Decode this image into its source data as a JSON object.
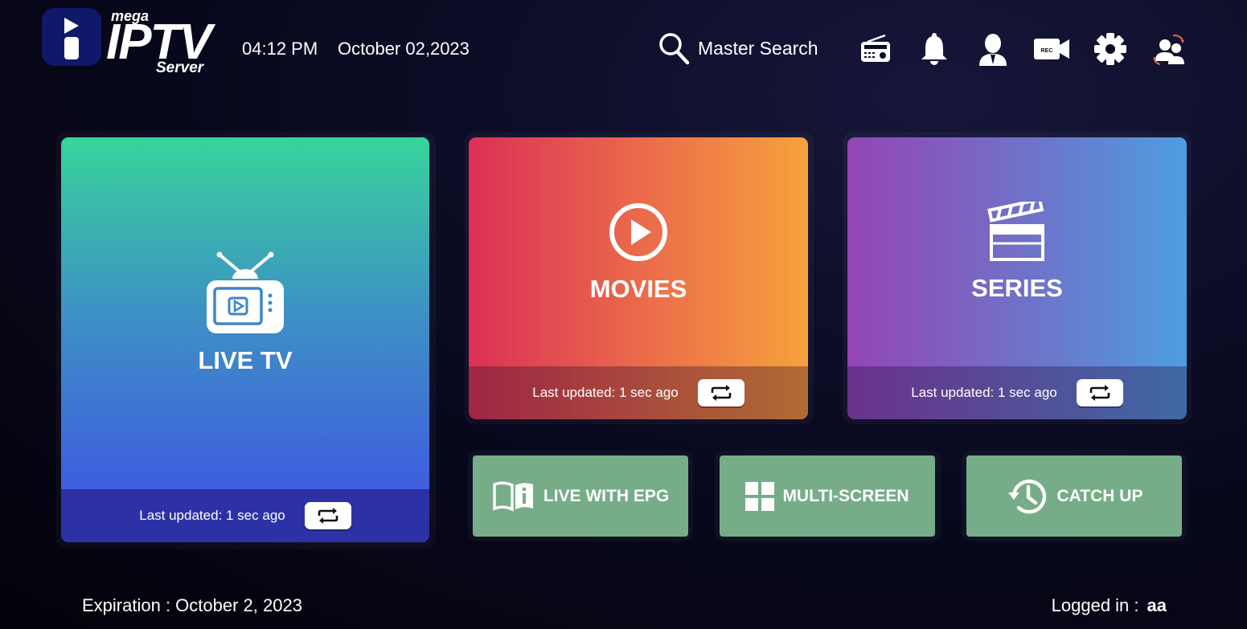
{
  "brand": {
    "name_top": "mega",
    "name_main": "IPTV",
    "name_bottom": "Server"
  },
  "header": {
    "time": "04:12 PM",
    "date": "October 02,2023",
    "search_label": "Master Search",
    "icons": [
      "radio-icon",
      "bell-icon",
      "user-icon",
      "record-icon",
      "gear-icon",
      "switch-user-icon"
    ]
  },
  "tiles": {
    "live": {
      "title": "LIVE TV",
      "updated": "Last updated: 1 sec ago"
    },
    "movies": {
      "title": "MOVIES",
      "updated": "Last updated: 1 sec ago"
    },
    "series": {
      "title": "SERIES",
      "updated": "Last updated: 1 sec ago"
    }
  },
  "shortcuts": [
    {
      "label": "LIVE WITH EPG",
      "icon": "book-info-icon"
    },
    {
      "label": "MULTI-SCREEN",
      "icon": "grid-icon"
    },
    {
      "label": "CATCH UP",
      "icon": "history-icon"
    }
  ],
  "footer": {
    "expiration": "Expiration : October 2, 2023",
    "logged_in_label": "Logged in :",
    "user": "aa"
  },
  "colors": {
    "live_top": "#38d49b",
    "live_bottom": "#3f4ee6",
    "movies_left": "#db3056",
    "movies_right": "#f6a23c",
    "series_left": "#9545b5",
    "series_right": "#4e9de0",
    "shortcut_bg": "#76ad88",
    "logo_badge": "#10186a"
  }
}
